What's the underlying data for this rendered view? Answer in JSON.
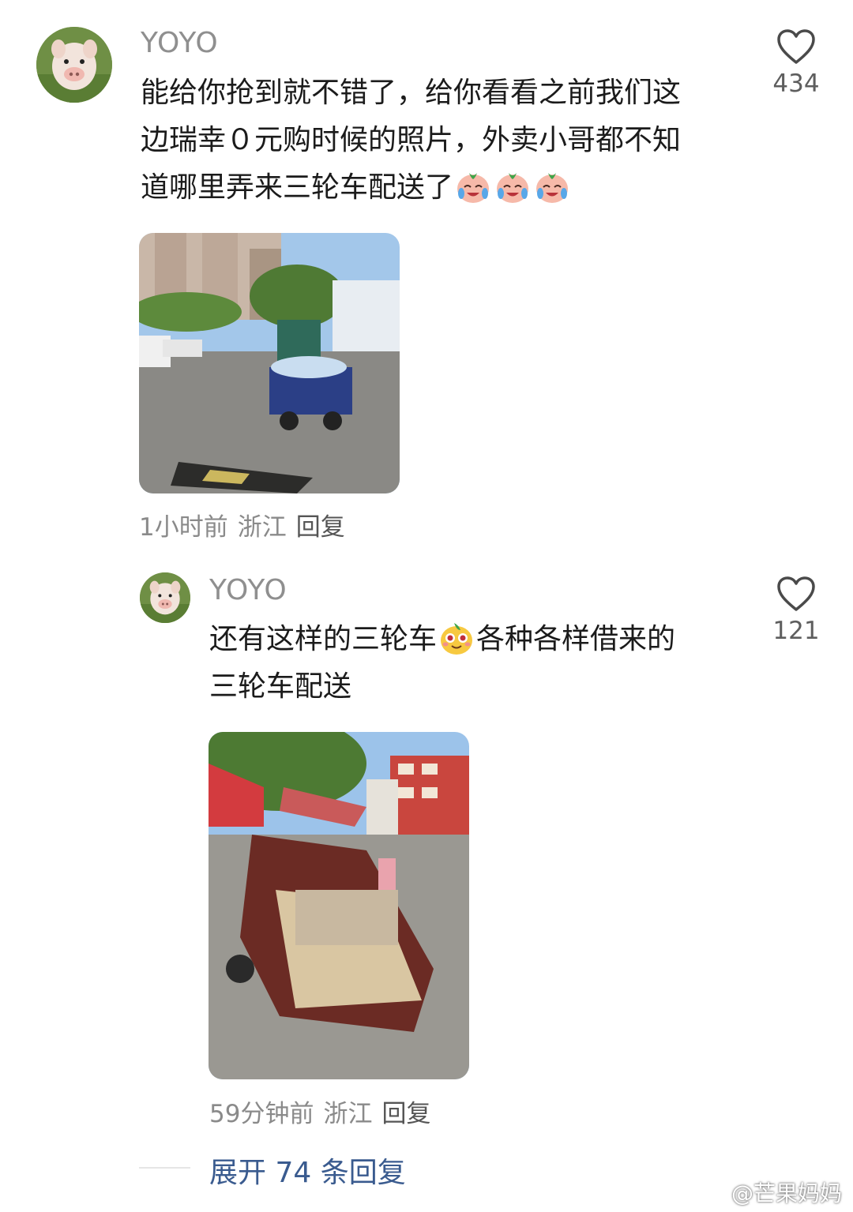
{
  "comments": [
    {
      "username": "YOYO",
      "text_lines": [
        "能给你抢到就不错了，给你看看之前我们这",
        "边瑞幸０元购时候的照片，外卖小哥都不知",
        "道哪里弄来三轮车配送了"
      ],
      "likes": "434",
      "meta": {
        "time": "1小时前",
        "location": "浙江",
        "reply": "回复"
      },
      "emoji_icon": "crying-laughing-emoji-icon"
    },
    {
      "username": "YOYO",
      "text_line1_a": "还有这样的三轮车",
      "text_line1_b": "各种各样借来的",
      "text_line2": "三轮车配送",
      "likes": "121",
      "meta": {
        "time": "59分钟前",
        "location": "浙江",
        "reply": "回复"
      },
      "emoji_icon": "mango-face-emoji-icon"
    }
  ],
  "expand_label": "展开 74 条回复",
  "watermark": "@芒果妈妈",
  "colors": {
    "link": "#3a5b8f",
    "meta": "#8a8a8a",
    "name": "#8f8f8f"
  }
}
